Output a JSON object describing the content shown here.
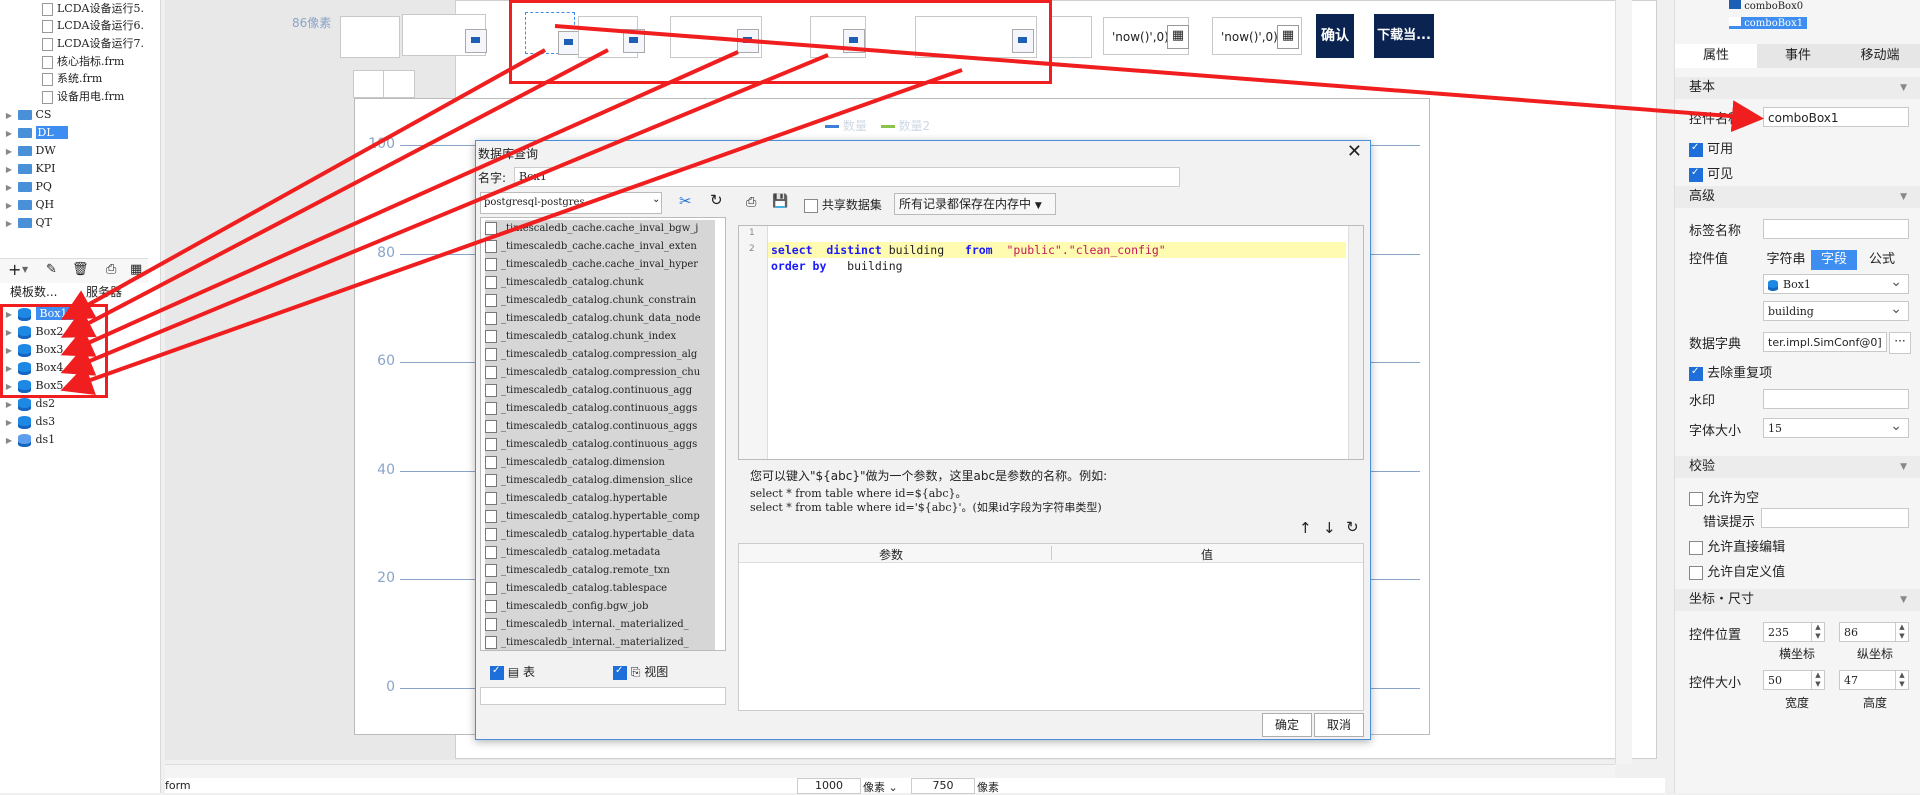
{
  "left_tree": {
    "top_files": [
      "LCDA设备运行5.",
      "LCDA设备运行6.",
      "LCDA设备运行7.",
      "核心指标.frm",
      "系统.frm",
      "设备用电.frm"
    ],
    "folders": [
      "CS",
      "DL",
      "DW",
      "KPI",
      "PQ",
      "QH",
      "QT"
    ],
    "tabs": [
      "模板数...",
      "服务器"
    ],
    "datasets": [
      "Box1",
      "Box2",
      "Box3",
      "Box4",
      "Box5",
      "ds2",
      "ds3",
      "ds1"
    ]
  },
  "canvas": {
    "ruler_label": "86像素",
    "date_value_1": "'now()',0)",
    "date_value_2": "'now()',0)",
    "confirm_button": "确认",
    "download_button": "下载当...",
    "y_axis_ticks": [
      "100",
      "80",
      "60",
      "40",
      "20",
      "0"
    ],
    "legend_items": [
      "数量",
      "数量2"
    ],
    "size_width": "1000",
    "size_height": "750",
    "unit_1": "像素 ⌄",
    "unit_2": "像素",
    "status_left": "form"
  },
  "dialog": {
    "title": "数据库查询",
    "name_label": "名字:",
    "name_value": "Box1",
    "connection": "postgresql-postgres",
    "share_label": "共享数据集",
    "memory_option": "所有记录都保存在内存中",
    "tables": [
      "_timescaledb_cache.cache_inval_bgw_j",
      "_timescaledb_cache.cache_inval_exten",
      "_timescaledb_cache.cache_inval_hyper",
      "_timescaledb_catalog.chunk",
      "_timescaledb_catalog.chunk_constrain",
      "_timescaledb_catalog.chunk_data_node",
      "_timescaledb_catalog.chunk_index",
      "_timescaledb_catalog.compression_alg",
      "_timescaledb_catalog.compression_chu",
      "_timescaledb_catalog.continuous_agg",
      "_timescaledb_catalog.continuous_aggs",
      "_timescaledb_catalog.continuous_aggs",
      "_timescaledb_catalog.continuous_aggs",
      "_timescaledb_catalog.dimension",
      "_timescaledb_catalog.dimension_slice",
      "_timescaledb_catalog.hypertable",
      "_timescaledb_catalog.hypertable_comp",
      "_timescaledb_catalog.hypertable_data",
      "_timescaledb_catalog.metadata",
      "_timescaledb_catalog.remote_txn",
      "_timescaledb_catalog.tablespace",
      "_timescaledb_config.bgw_job",
      "_timescaledb_internal._materialized_",
      "_timescaledb_internal._materialized_"
    ],
    "sql_line1_kw1": "select",
    "sql_line1_kw2": "distinct",
    "sql_line1_col": "building",
    "sql_line1_kw3": "from",
    "sql_line1_tbl": "\"public\".\"clean_config\"",
    "sql_line2_kw": "order by",
    "sql_line2_col": "building",
    "line_numbers": [
      "1",
      "2"
    ],
    "hint_title": "您可以键入\"${abc}\"做为一个参数，这里abc是参数的名称。例如:",
    "hint_ex1": "select * from table where id=${abc}。",
    "hint_ex2": "select * from table where id='${abc}'。(如果id字段为字符串类型)",
    "param_col": "参数",
    "value_col": "值",
    "table_check": "表",
    "view_check": "视图",
    "ok": "确定",
    "cancel": "取消"
  },
  "right_panel": {
    "tree_items": [
      "comboBox0",
      "comboBox1"
    ],
    "tabs": [
      "属性",
      "事件",
      "移动端"
    ],
    "sec_basic": "基本",
    "name_label": "控件名称",
    "name_value": "comboBox1",
    "enabled": "可用",
    "visible": "可见",
    "sec_advanced": "高级",
    "tag_label": "标签名称",
    "value_label": "控件值",
    "seg_string": "字符串",
    "seg_field": "字段",
    "seg_formula": "公式",
    "dataset_value": "Box1",
    "field_value": "building",
    "dict_label": "数据字典",
    "dict_value": "ter.impl.SimConf@0]",
    "dedup": "去除重复项",
    "watermark_label": "水印",
    "fontsize_label": "字体大小",
    "fontsize_value": "15",
    "sec_validate": "校验",
    "allow_empty": "允许为空",
    "error_label": "错误提示",
    "allow_edit": "允许直接编辑",
    "allow_custom": "允许自定义值",
    "sec_coord": "坐标・尺寸",
    "pos_label": "控件位置",
    "pos_x": "235",
    "pos_y": "86",
    "x_caption": "横坐标",
    "y_caption": "纵坐标",
    "size_label": "控件大小",
    "size_w": "50",
    "size_h": "47",
    "w_caption": "宽度",
    "h_caption": "高度"
  },
  "colors": {
    "accent": "#3d8ef0",
    "annotation": "#f01e1e",
    "dark_button": "#0b2350",
    "sql_keyword": "#1a1aff",
    "sql_string": "#c2185b"
  }
}
